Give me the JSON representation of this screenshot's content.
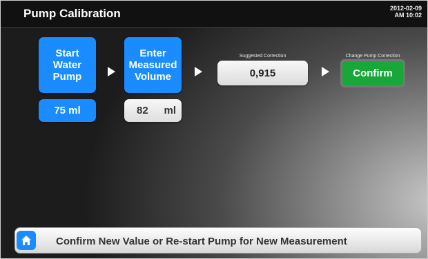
{
  "header": {
    "title": "Pump Calibration",
    "date": "2012-02-09",
    "time": "AM 10:02"
  },
  "steps": {
    "start_pump": [
      "Start",
      "Water",
      "Pump"
    ],
    "enter_volume": [
      "Enter",
      "Measured",
      "Volume"
    ]
  },
  "volumes": {
    "target": "75 ml",
    "measured_value": "82",
    "measured_unit": "ml"
  },
  "correction": {
    "label": "Suggested Correction",
    "value": "0,915"
  },
  "change": {
    "label": "Change Pump Correction",
    "button": "Confirm"
  },
  "status": {
    "message": "Confirm New Value or Re-start Pump for New Measurement"
  },
  "icons": [
    "home-icon",
    "arrow-right-icon"
  ],
  "colors": {
    "accent_blue": "#1a8cff",
    "confirm_green": "#18a83a",
    "header_bg": "#111111"
  }
}
